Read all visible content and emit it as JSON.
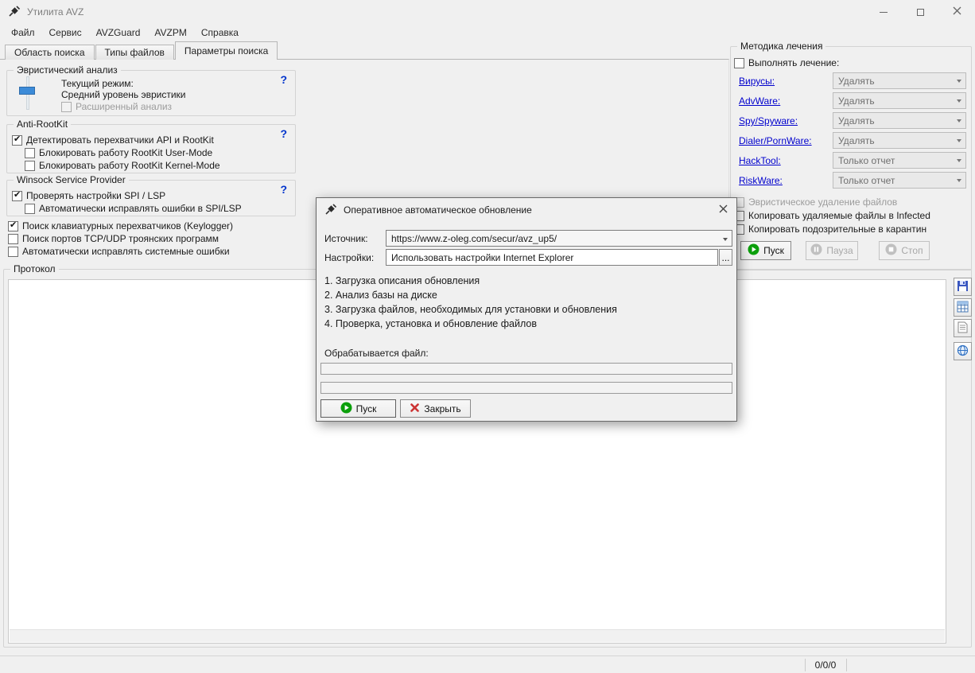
{
  "titlebar": {
    "title": "Утилита AVZ"
  },
  "menubar": {
    "items": [
      {
        "label": "Файл"
      },
      {
        "label": "Сервис"
      },
      {
        "label": "AVZGuard"
      },
      {
        "label": "AVZPM"
      },
      {
        "label": "Справка"
      }
    ]
  },
  "tabs": {
    "items": [
      {
        "label": "Область поиска",
        "active": false
      },
      {
        "label": "Типы файлов",
        "active": false
      },
      {
        "label": "Параметры поиска",
        "active": true
      }
    ]
  },
  "search_params": {
    "heuristics": {
      "title": "Эвристический анализ",
      "help": "?",
      "current_mode_label": "Текущий режим:",
      "current_mode_value": "Средний уровень эвристики",
      "extended_option": {
        "label": "Расширенный анализ",
        "checked": false,
        "disabled": true
      }
    },
    "antirootkit": {
      "title": "Anti-RootKit",
      "help": "?",
      "options": [
        {
          "label": "Детектировать перехватчики API и RootKit",
          "checked": true
        },
        {
          "label": "Блокировать работу RootKit User-Mode",
          "checked": false
        },
        {
          "label": "Блокировать работу RootKit Kernel-Mode",
          "checked": false
        }
      ]
    },
    "winsock": {
      "title": "Winsock  Service Provider",
      "help": "?",
      "options": [
        {
          "label": "Проверять настройки SPI / LSP",
          "checked": true
        },
        {
          "label": "Автоматически исправлять ошибки в SPI/LSP",
          "checked": false
        }
      ]
    },
    "misc_options": [
      {
        "label": "Поиск клавиатурных перехватчиков (Keylogger)",
        "checked": true
      },
      {
        "label": "Поиск портов TCP/UDP троянских программ",
        "checked": false
      },
      {
        "label": "Автоматически исправлять системные ошибки",
        "checked": false
      }
    ]
  },
  "protocol": {
    "title": "Протокол"
  },
  "treatment": {
    "title": "Методика лечения",
    "perform_option": {
      "label": "Выполнять лечение:",
      "checked": false
    },
    "categories": [
      {
        "label": "Вирусы:",
        "action": "Удалять"
      },
      {
        "label": "AdvWare:",
        "action": "Удалять"
      },
      {
        "label": "Spy/Spyware:",
        "action": "Удалять"
      },
      {
        "label": "Dialer/PornWare:",
        "action": "Удалять"
      },
      {
        "label": "HackTool:",
        "action": "Только отчет"
      },
      {
        "label": "RiskWare:",
        "action": "Только отчет"
      }
    ],
    "options": [
      {
        "label": "Эвристическое удаление файлов",
        "checked": false,
        "disabled": true
      },
      {
        "label": "Копировать удаляемые файлы в  Infected",
        "checked": false,
        "disabled": false
      },
      {
        "label": "Копировать подозрительные в  карантин",
        "checked": false,
        "disabled": false
      }
    ],
    "buttons": {
      "start": "Пуск",
      "pause": "Пауза",
      "stop": "Стоп"
    }
  },
  "update_dialog": {
    "title": "Оперативное автоматическое обновление",
    "source_label": "Источник:",
    "source_value": "https://www.z-oleg.com/secur/avz_up5/",
    "settings_label": "Настройки:",
    "settings_value": "Использовать настройки Internet Explorer",
    "browse_label": "...",
    "steps": [
      "1. Загрузка описания обновления",
      "2. Анализ базы на диске",
      "3. Загрузка файлов, необходимых для установки и обновления",
      "4. Проверка, установка и обновление файлов"
    ],
    "processing_label": "Обрабатывается файл:",
    "buttons": {
      "start": "Пуск",
      "close": "Закрыть"
    }
  },
  "statusbar": {
    "counters": "0/0/0"
  },
  "colors": {
    "link": "#0000cd",
    "help": "#0033cc",
    "play_green": "#0b9f0b",
    "close_red": "#cc3333",
    "slider_blue": "#3c8bd8",
    "window_bg": "#f0f0f0"
  }
}
